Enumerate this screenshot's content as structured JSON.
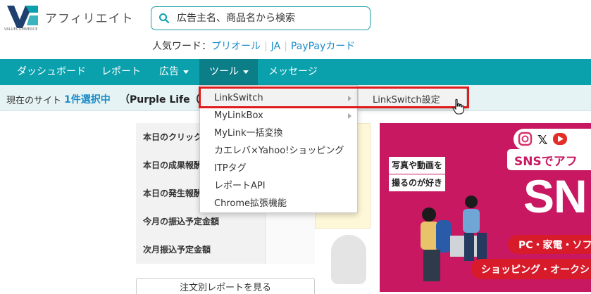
{
  "header": {
    "logo_text": "アフィリエイト",
    "logo_sub": "VALUECOMMERCE",
    "search_placeholder": "広告主名、商品名から検索",
    "popular_label": "人気ワード：",
    "popular_words": [
      "プリオール",
      "JA",
      "PayPayカード"
    ]
  },
  "nav": {
    "items": [
      {
        "label": "ダッシュボード"
      },
      {
        "label": "レポート"
      },
      {
        "label": "広告"
      },
      {
        "label": "ツール"
      },
      {
        "label": "メッセージ"
      }
    ]
  },
  "sitebar": {
    "label": "現在のサイト",
    "selected": "1件選択中",
    "site_name": "（Purple Life（ID"
  },
  "dropdown": {
    "items": [
      {
        "label": "LinkSwitch"
      },
      {
        "label": "MyLinkBox"
      },
      {
        "label": "MyLink一括変換"
      },
      {
        "label": "カエレバ×Yahoo!ショッピング"
      },
      {
        "label": "ITPタグ"
      },
      {
        "label": "レポートAPI"
      },
      {
        "label": "Chrome拡張機能"
      }
    ],
    "submenu_label": "LinkSwitch設定"
  },
  "stats": {
    "rows": [
      {
        "label": "本日のクリック"
      },
      {
        "label": "本日の成果報酬"
      },
      {
        "label": "本日の発生報酬"
      },
      {
        "label": "今月の振込予定金額"
      },
      {
        "label": "次月振込予定金額"
      }
    ],
    "report_button": "注文別レポートを見る"
  },
  "banner": {
    "caption1": "写真や動画を",
    "caption2": "撮るのが好き",
    "headline": "SNSでアフ",
    "big_text": "SN",
    "pill1": "PC・家電・ソフ",
    "pill2": "ショッピング・オークシ"
  },
  "colors": {
    "nav_bg": "#0aa1ad",
    "nav_active": "#0b7e88",
    "link": "#1a8bc7",
    "highlight": "#e01b1b",
    "banner_bg": "#c81862"
  }
}
